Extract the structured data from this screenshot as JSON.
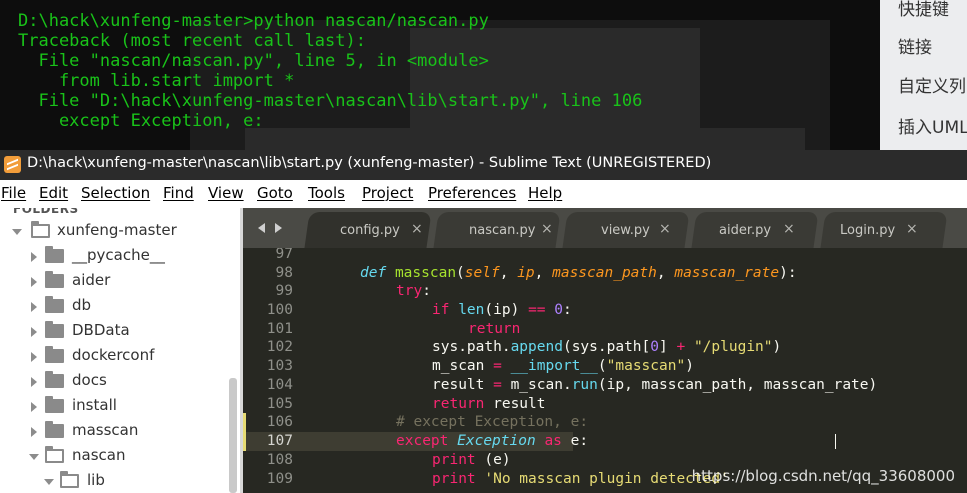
{
  "terminal": {
    "lines": [
      "D:\\hack\\xunfeng-master>python nascan/nascan.py",
      "Traceback (most recent call last):",
      "  File \"nascan/nascan.py\", line 5, in <module>",
      "    from lib.start import *",
      "  File \"D:\\hack\\xunfeng-master\\nascan\\lib\\start.py\", line 106",
      "    except Exception, e:"
    ],
    "text_color": "#19c219"
  },
  "side_panel": {
    "items": [
      "快捷键",
      "链接",
      "自定义列",
      "插入UML"
    ]
  },
  "window": {
    "title": "D:\\hack\\xunfeng-master\\nascan\\lib\\start.py (xunfeng-master) - Sublime Text (UNREGISTERED)",
    "icon": "sublime-text-icon"
  },
  "menu": {
    "items": [
      "File",
      "Edit",
      "Selection",
      "Find",
      "View",
      "Goto",
      "Tools",
      "Project",
      "Preferences",
      "Help"
    ]
  },
  "sidebar": {
    "header": "FOLDERS",
    "items": [
      {
        "label": "xunfeng-master",
        "expanded": true
      },
      {
        "label": "__pycache__",
        "expanded": false
      },
      {
        "label": "aider",
        "expanded": false
      },
      {
        "label": "db",
        "expanded": false
      },
      {
        "label": "DBData",
        "expanded": false
      },
      {
        "label": "dockerconf",
        "expanded": false
      },
      {
        "label": "docs",
        "expanded": false
      },
      {
        "label": "install",
        "expanded": false
      },
      {
        "label": "masscan",
        "expanded": false
      },
      {
        "label": "nascan",
        "expanded": true
      },
      {
        "label": "lib",
        "expanded": true
      }
    ]
  },
  "tabs": [
    {
      "label": "config.py"
    },
    {
      "label": "nascan.py"
    },
    {
      "label": "view.py"
    },
    {
      "label": "aider.py"
    },
    {
      "label": "Login.py"
    }
  ],
  "tab_close_glyph": "×",
  "editor": {
    "line_numbers": [
      "97",
      "98",
      "99",
      "100",
      "101",
      "102",
      "103",
      "104",
      "105",
      "106",
      "107",
      "108",
      "109"
    ],
    "active_line": "107",
    "code": {
      "l98_def": "def",
      "l98_name": "masscan",
      "l98_open": "(",
      "l98_self": "self",
      "l98_c1": ", ",
      "l98_ip": "ip",
      "l98_c2": ", ",
      "l98_path": "masscan_path",
      "l98_c3": ", ",
      "l98_rate": "masscan_rate",
      "l98_close": "):",
      "l99_try": "try",
      "l99_colon": ":",
      "l100_if": "if",
      "l100_sp": " ",
      "l100_len": "len",
      "l100_args": "(ip) ",
      "l100_eq": "==",
      "l100_sp2": " ",
      "l100_zero": "0",
      "l100_colon": ":",
      "l101_return": "return",
      "l102_a": "sys.path.",
      "l102_append": "append",
      "l102_b": "(sys.path[",
      "l102_zero": "0",
      "l102_c": "] ",
      "l102_plus": "+",
      "l102_sp": " ",
      "l102_str": "\"/plugin\"",
      "l102_d": ")",
      "l103_a": "m_scan ",
      "l103_eq": "=",
      "l103_sp": " ",
      "l103_import": "__import__",
      "l103_b": "(",
      "l103_str": "\"masscan\"",
      "l103_c": ")",
      "l104_a": "result ",
      "l104_eq": "=",
      "l104_b": " m_scan.",
      "l104_run": "run",
      "l104_c": "(ip, masscan_path, masscan_rate)",
      "l105_return": "return",
      "l105_rest": " result",
      "l106_comment": "# except Exception, e:",
      "l107_except": "except",
      "l107_sp": " ",
      "l107_exc": "Exception",
      "l107_sp2": " ",
      "l107_as": "as",
      "l107_rest": " e:",
      "l108_print": "print",
      "l108_rest": " (e)",
      "l109_print": "print",
      "l109_sp": " ",
      "l109_str": "'No masscan plugin detected'"
    }
  },
  "watermark": "https://blog.csdn.net/qq_33608000"
}
